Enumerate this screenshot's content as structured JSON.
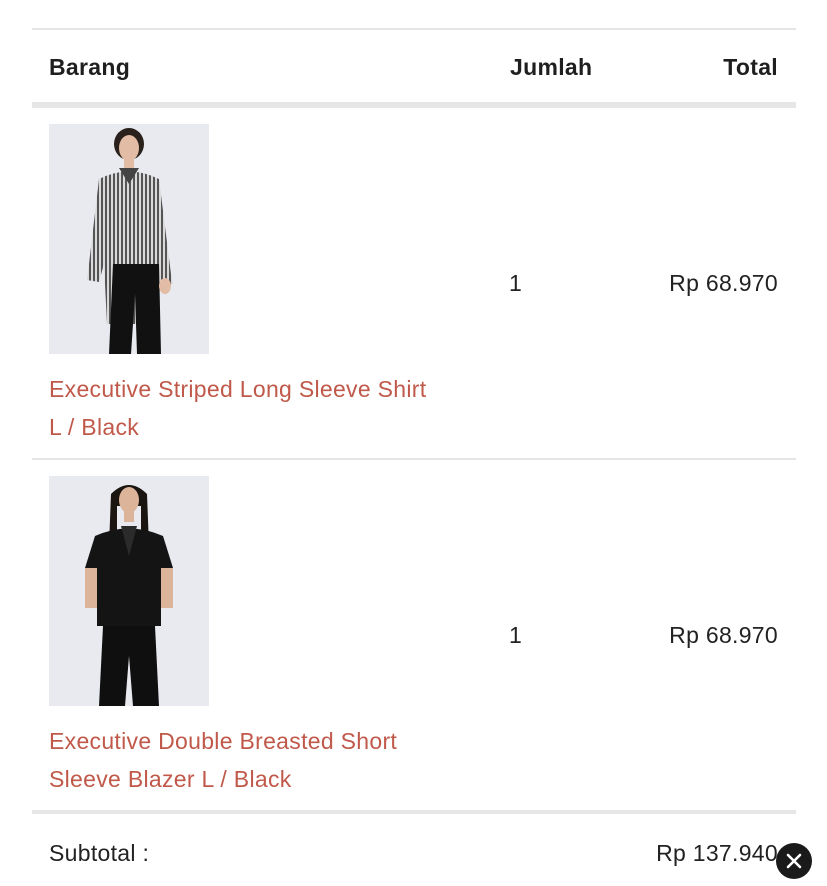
{
  "table": {
    "headers": {
      "item": "Barang",
      "quantity": "Jumlah",
      "total": "Total"
    },
    "items": [
      {
        "name_line1": "Executive Striped Long Sleeve Shirt",
        "name_line2": "L / Black",
        "quantity": "1",
        "price": "Rp 68.970",
        "image_icon": "striped-shirt-product-photo"
      },
      {
        "name_line1": "Executive Double Breasted Short",
        "name_line2": "Sleeve Blazer L / Black",
        "quantity": "1",
        "price": "Rp 68.970",
        "image_icon": "black-blazer-product-photo"
      }
    ],
    "subtotal": {
      "label": "Subtotal :",
      "value": "Rp 137.940"
    }
  },
  "close_icon": "close-icon",
  "colors": {
    "link": "#c0594a",
    "text": "#222222",
    "divider": "#e6e6e6",
    "photo_bg": "#e8eaf0"
  }
}
